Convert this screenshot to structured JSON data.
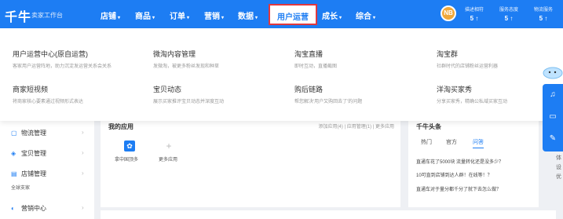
{
  "brand": {
    "logo": "千牛",
    "subtitle": "卖家工作台"
  },
  "nav": {
    "items": [
      {
        "label": "店铺",
        "caret": "▾"
      },
      {
        "label": "商品",
        "caret": "▾"
      },
      {
        "label": "订单",
        "caret": "▾"
      },
      {
        "label": "营销",
        "caret": "▾"
      },
      {
        "label": "数据",
        "caret": "▾"
      },
      {
        "label": "用户运营",
        "caret": "^"
      },
      {
        "label": "成长",
        "caret": "▾"
      },
      {
        "label": "综合",
        "caret": "▾"
      }
    ],
    "active_index": 5,
    "accent": "#1d7df3",
    "highlight_border": "#e0383e"
  },
  "user": {
    "avatar_text": "NB",
    "stats": [
      {
        "label": "描述相符",
        "value": "5 ↑"
      },
      {
        "label": "服务态度",
        "value": "5 ↑"
      },
      {
        "label": "物流服务",
        "value": "5 ↑"
      }
    ]
  },
  "mega_menu": {
    "items": [
      {
        "title": "用户运营中心(原自运营)",
        "desc": "客家用户运营阵地，助力沉淀发运营关系会关系"
      },
      {
        "title": "微淘内容管理",
        "desc": "发微淘，被更多粉丝发现和种草"
      },
      {
        "title": "淘宝直播",
        "desc": "即时互动，直播截图"
      },
      {
        "title": "淘宝群",
        "desc": "社群时代的店铺粉丝运营利器"
      },
      {
        "title": "商家短视频",
        "desc": "将商家核心要素通过视频形式表达"
      },
      {
        "title": "宝贝动态",
        "desc": "展示买家推评宝贝动态并深度互动"
      },
      {
        "title": "购后链路",
        "desc": "帮您解决'用户又购回去了'的问题"
      },
      {
        "title": "洋淘买家秀",
        "desc": "分享买家秀，精确公私域买家互动"
      }
    ]
  },
  "sidebar": {
    "items": [
      {
        "icon": "truck-icon",
        "glyph": "▢",
        "label": "物流管理",
        "chevron": "›"
      },
      {
        "icon": "box-icon",
        "glyph": "◈",
        "label": "宝贝管理",
        "chevron": "›"
      },
      {
        "icon": "shop-icon",
        "glyph": "▤",
        "label": "店铺管理",
        "chevron": "›"
      },
      {
        "icon": "marketing-icon",
        "glyph": "◐",
        "label": "营销中心",
        "chevron": "›"
      }
    ],
    "sub_text": "全球支家"
  },
  "apps": {
    "title": "我的应用",
    "links": "添加应用(4) | 应用管理(1) | 更多应用",
    "items": [
      {
        "label": "拿中国顶多"
      },
      {
        "label": "更多应用"
      }
    ]
  },
  "news": {
    "title": "千牛头条",
    "tabs": [
      "热门",
      "官方",
      "问答"
    ],
    "active_tab": 2,
    "lines": [
      "直通车花了5000块 流量转化还是没多少？",
      "10可直到店铺到达人群！在线等！？",
      "直通车对于量分都千分了就下去怎么做？"
    ],
    "edge_text": [
      "体",
      "设",
      "优"
    ]
  },
  "float_toolbar": [
    {
      "icon": "bell-icon",
      "glyph": "♫"
    },
    {
      "icon": "chat-icon",
      "glyph": "▭"
    },
    {
      "icon": "tools-icon",
      "glyph": "✎"
    }
  ]
}
